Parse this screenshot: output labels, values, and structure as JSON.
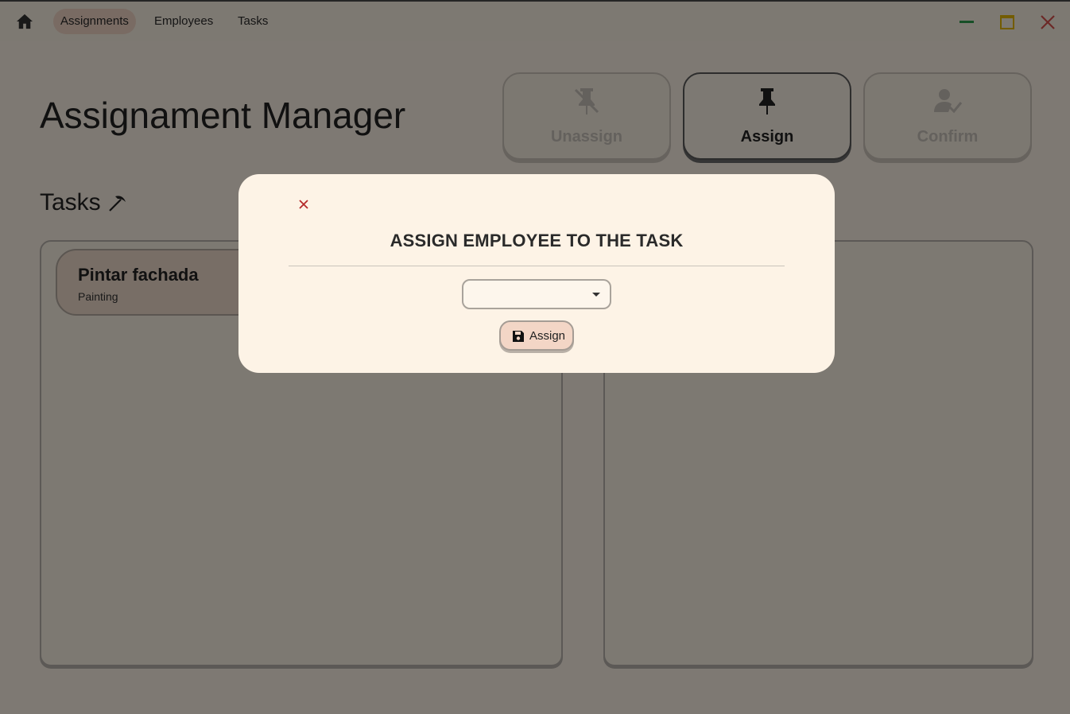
{
  "nav": {
    "items": [
      {
        "label": "Assignments",
        "active": true
      },
      {
        "label": "Employees",
        "active": false
      },
      {
        "label": "Tasks",
        "active": false
      }
    ]
  },
  "window_controls": {
    "minimize_color": "#2e9e4f",
    "maximize_color": "#e6b800",
    "close_color": "#d9534f"
  },
  "page": {
    "title": "Assignament Manager",
    "actions": [
      {
        "label": "Unassign",
        "icon": "unpin-icon",
        "enabled": false
      },
      {
        "label": "Assign",
        "icon": "pin-icon",
        "enabled": true
      },
      {
        "label": "Confirm",
        "icon": "user-check-icon",
        "enabled": false
      }
    ],
    "tasks_section": {
      "title": "Tasks",
      "icon": "pickaxe-icon",
      "items": [
        {
          "name": "Pintar fachada",
          "category": "Painting"
        }
      ]
    }
  },
  "dialog": {
    "title": "ASSIGN EMPLOYEE TO THE TASK",
    "employee_select": {
      "value": ""
    },
    "assign_button": {
      "label": "Assign",
      "icon": "save-icon"
    },
    "close_icon": "close-icon",
    "close_color": "#b52a2a"
  }
}
